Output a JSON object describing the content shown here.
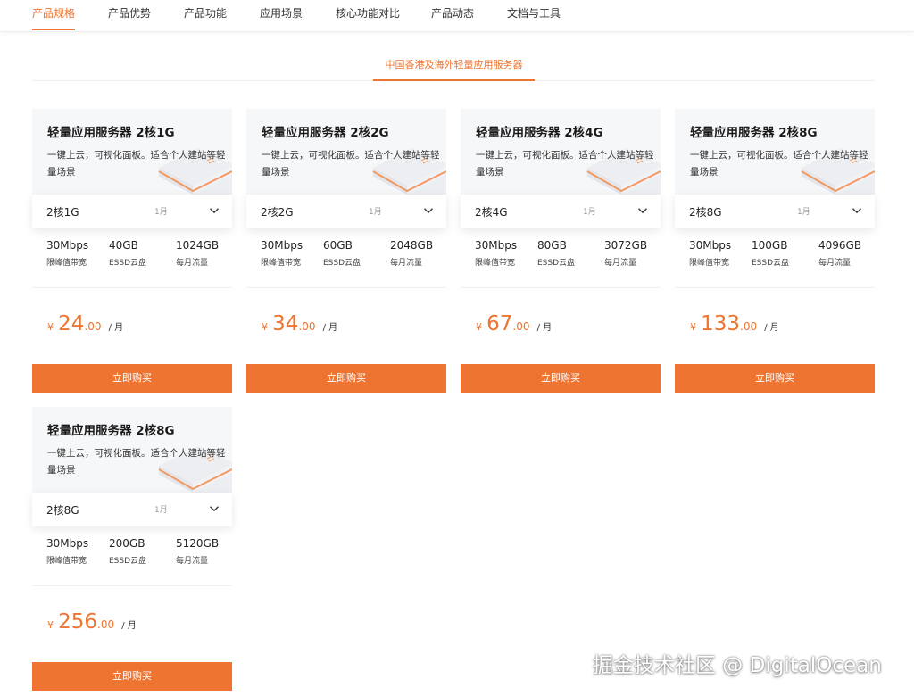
{
  "nav": {
    "tabs": [
      {
        "label": "产品规格",
        "active": true
      },
      {
        "label": "产品优势",
        "active": false
      },
      {
        "label": "产品功能",
        "active": false
      },
      {
        "label": "应用场景",
        "active": false
      },
      {
        "label": "核心功能对比",
        "active": false
      },
      {
        "label": "产品动态",
        "active": false
      },
      {
        "label": "文档与工具",
        "active": false
      }
    ]
  },
  "subtab": {
    "label": "中国香港及海外轻量应用服务器"
  },
  "colors": {
    "accent": "#ed7431",
    "card_bg": "#f6f7f9"
  },
  "plans": [
    {
      "title": "轻量应用服务器 2核1G",
      "desc": "一键上云，可视化面板。适合个人建站等轻量场景",
      "select": "2核1G",
      "period": "1月",
      "bandwidth": "30Mbps",
      "bandwidth_label": "限峰值带宽",
      "disk": "40GB",
      "disk_label": "ESSD云盘",
      "traffic": "1024GB",
      "traffic_label": "每月流量",
      "currency": "¥",
      "price_int": "24",
      "price_dec": ".00",
      "price_unit": "/ 月",
      "buy": "立即购买"
    },
    {
      "title": "轻量应用服务器 2核2G",
      "desc": "一键上云，可视化面板。适合个人建站等轻量场景",
      "select": "2核2G",
      "period": "1月",
      "bandwidth": "30Mbps",
      "bandwidth_label": "限峰值带宽",
      "disk": "60GB",
      "disk_label": "ESSD云盘",
      "traffic": "2048GB",
      "traffic_label": "每月流量",
      "currency": "¥",
      "price_int": "34",
      "price_dec": ".00",
      "price_unit": "/ 月",
      "buy": "立即购买"
    },
    {
      "title": "轻量应用服务器 2核4G",
      "desc": "一键上云，可视化面板。适合个人建站等轻量场景",
      "select": "2核4G",
      "period": "1月",
      "bandwidth": "30Mbps",
      "bandwidth_label": "限峰值带宽",
      "disk": "80GB",
      "disk_label": "ESSD云盘",
      "traffic": "3072GB",
      "traffic_label": "每月流量",
      "currency": "¥",
      "price_int": "67",
      "price_dec": ".00",
      "price_unit": "/ 月",
      "buy": "立即购买"
    },
    {
      "title": "轻量应用服务器 2核8G",
      "desc": "一键上云，可视化面板。适合个人建站等轻量场景",
      "select": "2核8G",
      "period": "1月",
      "bandwidth": "30Mbps",
      "bandwidth_label": "限峰值带宽",
      "disk": "100GB",
      "disk_label": "ESSD云盘",
      "traffic": "4096GB",
      "traffic_label": "每月流量",
      "currency": "¥",
      "price_int": "133",
      "price_dec": ".00",
      "price_unit": "/ 月",
      "buy": "立即购买"
    },
    {
      "title": "轻量应用服务器 2核8G",
      "desc": "一键上云，可视化面板。适合个人建站等轻量场景",
      "select": "2核8G",
      "period": "1月",
      "bandwidth": "30Mbps",
      "bandwidth_label": "限峰值带宽",
      "disk": "200GB",
      "disk_label": "ESSD云盘",
      "traffic": "5120GB",
      "traffic_label": "每月流量",
      "currency": "¥",
      "price_int": "256",
      "price_dec": ".00",
      "price_unit": "/ 月",
      "buy": "立即购买"
    }
  ],
  "watermark": "掘金技术社区 @ DigitalOcean"
}
